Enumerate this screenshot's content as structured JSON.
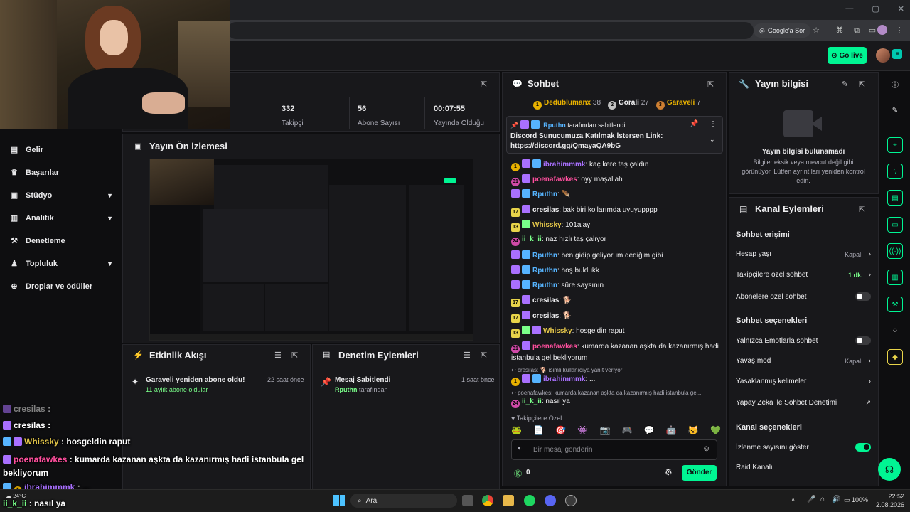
{
  "browser": {
    "google_sor": "Google'a Sor"
  },
  "header": {
    "go_live": "Go live"
  },
  "sidebar": {
    "items": [
      {
        "label": "Gelir",
        "icon": "revenue-icon"
      },
      {
        "label": "Başarılar",
        "icon": "trophy-icon"
      },
      {
        "label": "Stüdyo",
        "icon": "studio-icon"
      },
      {
        "label": "Analitik",
        "icon": "analytics-icon"
      },
      {
        "label": "Denetleme",
        "icon": "moderation-icon"
      },
      {
        "label": "Topluluk",
        "icon": "community-icon"
      },
      {
        "label": "Droplar ve ödüller",
        "icon": "drops-icon"
      }
    ]
  },
  "stats": {
    "followers_value": "332",
    "followers_label": "Takipçi",
    "subs_value": "56",
    "subs_label": "Abone Sayısı",
    "uptime_value": "00:07:55",
    "uptime_label": "Yayında Olduğu Süre"
  },
  "preview": {
    "title": "Yayın Ön İzlemesi"
  },
  "activity": {
    "title": "Etkinlik Akışı",
    "item_title": "Garaveli yeniden abone oldu!",
    "item_sub": "11 aylık abone oldular",
    "item_time": "22 saat önce"
  },
  "modlog": {
    "title": "Denetim Eylemleri",
    "item_title": "Mesaj Sabitlendi",
    "item_user": "Rputhn",
    "item_sub": "tarafından",
    "item_time": "1 saat önce"
  },
  "chat": {
    "title": "Sohbet",
    "leaders": [
      {
        "rank": "1",
        "name": "Dedublumanx",
        "count": "38",
        "color": "#e8b100"
      },
      {
        "rank": "2",
        "name": "Gorali",
        "count": "27",
        "color": "#c0c0c0"
      },
      {
        "rank": "3",
        "name": "Garaveli",
        "count": "7",
        "color": "#cd7f32"
      }
    ],
    "pinned_by_user": "Rputhn",
    "pinned_by_suffix": "tarafından sabitlendi",
    "pinned_text": "Discord Sunucumuza Katılmak İstersen Link:",
    "pinned_link": "https://discord.gg/QmayaQA9bG",
    "messages": [
      {
        "user": "ibrahimmmk",
        "color": "#a970ff",
        "text": ": kaç kere taş çaldın"
      },
      {
        "user": "poenafawkes",
        "color": "#ff4f9e",
        "text": ": oyy maşallah"
      },
      {
        "user": "Rputhn",
        "color": "#56b4ff",
        "text": ":"
      },
      {
        "user": "cresilas",
        "color": "#efeff1",
        "text": ": bak biri kollarımda uyuyupppp"
      },
      {
        "user": "Whissky",
        "color": "#e6c84a",
        "text": ": 101alay"
      },
      {
        "user": "ii_k_ii",
        "color": "#7aff8a",
        "text": ": naz hızlı taş çalıyor"
      },
      {
        "user": "Rputhn",
        "color": "#56b4ff",
        "text": ": ben gidip geliyorum dediğim gibi"
      },
      {
        "user": "Rputhn",
        "color": "#56b4ff",
        "text": ": hoş buldukk"
      },
      {
        "user": "Rputhn",
        "color": "#56b4ff",
        "text": ": süre saysının"
      },
      {
        "user": "cresilas",
        "color": "#efeff1",
        "text": ":"
      },
      {
        "user": "cresilas",
        "color": "#efeff1",
        "text": ":"
      },
      {
        "user": "Whissky",
        "color": "#e6c84a",
        "text": ": hosgeldin raput"
      },
      {
        "user": "poenafawkes",
        "color": "#ff4f9e",
        "text": ": kumarda kazanan aşkta da kazanırmış hadi istanbula gel bekliyorum"
      }
    ],
    "reply1_prefix": "cresilas:",
    "reply1_text": "isimli kullanıcıya yanıt veriyor",
    "reply1_user": "ibrahimmmk",
    "reply1_msg": ": ...",
    "reply2_text": "poenafawkes: kumarda kazanan aşkta da kazanırmış hadi istanbula ge...",
    "reply2_user": "ii_k_ii",
    "reply2_msg": ": nasıl ya",
    "emote_section": "Takipçilere Özel",
    "input_placeholder": "Bir mesaj gönderin",
    "points": "0",
    "send": "Gönder"
  },
  "streaminfo": {
    "title": "Yayın bilgisi",
    "empty_title": "Yayın bilgisi bulunamadı",
    "empty_text": "Bilgiler eksik veya mevcut değil gibi görünüyor. Lütfen ayrıntıları yeniden kontrol edin."
  },
  "channel": {
    "title": "Kanal Eylemleri",
    "access_heading": "Sohbet erişimi",
    "account_age": "Hesap yaşı",
    "account_age_val": "Kapalı",
    "followers_only": "Takipçilere özel sohbet",
    "followers_only_val": "1 dk.",
    "subs_only": "Abonelere özel sohbet",
    "options_heading": "Sohbet seçenekleri",
    "emote_only": "Yalnızca Emotlarla sohbet",
    "slow_mode": "Yavaş mod",
    "slow_mode_val": "Kapalı",
    "banned_words": "Yasaklanmış kelimeler",
    "ai_mod": "Yapay Zeka ile Sohbet Denetimi",
    "channel_options": "Kanal seçenekleri",
    "show_viewers": "İzlenme sayısını göster",
    "raid": "Raid Kanalı"
  },
  "overlay": {
    "lines": [
      {
        "user": "cresilas",
        "text": ":"
      },
      {
        "user": "cresilas",
        "text": ":"
      },
      {
        "user": "Whissky",
        "text": ": hosgeldin raput"
      },
      {
        "user": "poenafawkes",
        "text": ": kumarda kazanan aşkta da kazanırmış hadi istanbula gel bekliyorum"
      },
      {
        "user": "ibrahimmmk",
        "text": ": ..."
      },
      {
        "user": "ii_k_ii",
        "text": ": nasıl ya"
      }
    ]
  },
  "taskbar": {
    "search": "Ara",
    "weather": "24°C",
    "battery": "100%",
    "time": "22:52",
    "date": "2.08.2026"
  }
}
